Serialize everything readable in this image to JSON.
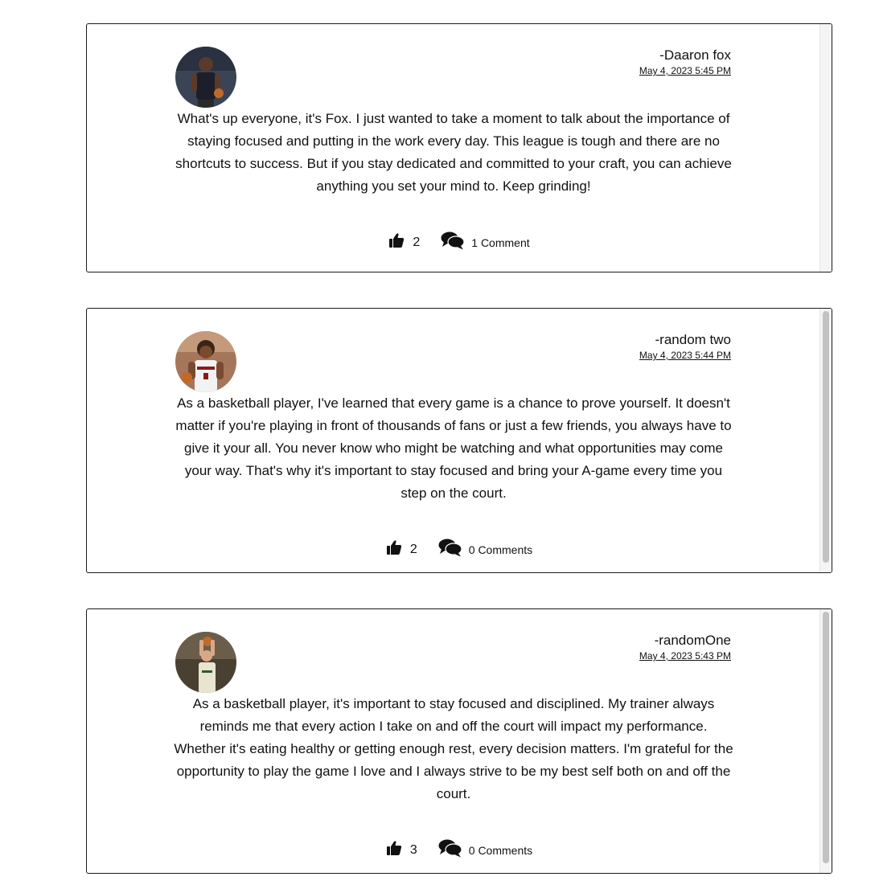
{
  "posts": [
    {
      "author": "-Daaron fox",
      "date": "May 4, 2023 5:45 PM",
      "body": "What's up everyone, it's Fox. I just wanted to take a moment to talk about the importance of staying focused and putting in the work every day. This league is tough and there are no shortcuts to success. But if you stay dedicated and committed to your craft, you can achieve anything you set your mind to. Keep grinding!",
      "likes": "2",
      "comments": "1 Comment",
      "avatar_icon": "player-avatar",
      "avatar_colors": {
        "bg": "#3b4454",
        "jersey": "#1c1f2a"
      }
    },
    {
      "author": "-random two",
      "date": "May 4, 2023 5:44 PM",
      "body": "As a basketball player, I've learned that every game is a chance to prove yourself. It doesn't matter if you're playing in front of thousands of fans or just a few friends, you always have to give it your all. You never know who might be watching and what opportunities may come your way. That's why it's important to stay focused and bring your A-game every time you step on the court.",
      "likes": "2",
      "comments": "0 Comments",
      "avatar_icon": "player-avatar",
      "avatar_colors": {
        "bg": "#a6765a",
        "jersey": "#f2f2f2"
      }
    },
    {
      "author": "-randomOne",
      "date": "May 4, 2023 5:43 PM",
      "body": "As a basketball player, it's important to stay focused and disciplined. My trainer always reminds me that every action I take on and off the court will impact my performance. Whether it's eating healthy or getting enough rest, every decision matters. I'm grateful for the opportunity to play the game I love and I always strive to be my best self both on and off the court.",
      "likes": "3",
      "comments": "0 Comments",
      "avatar_icon": "player-avatar",
      "avatar_colors": {
        "bg": "#4a4032",
        "jersey": "#e8e4d0"
      }
    }
  ],
  "icons": {
    "like": "thumbs-up-icon",
    "comment": "comments-icon"
  }
}
